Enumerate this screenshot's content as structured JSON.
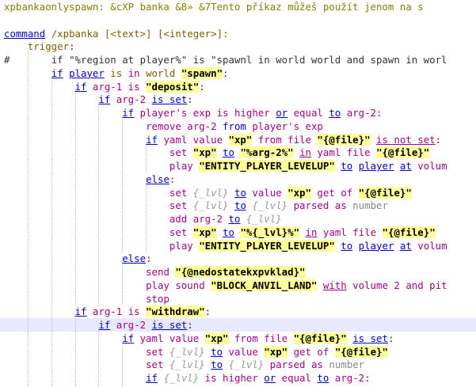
{
  "editor": {
    "lines": [
      {
        "indent": 0,
        "tokens": [
          {
            "t": "xpbankaonlyspawn: &cXP banka &8» &7Tento příkaz můžeš použít jenom na s",
            "c": "olv"
          }
        ]
      },
      {
        "indent": 0,
        "tokens": []
      },
      {
        "indent": 0,
        "tokens": [
          {
            "t": "command",
            "c": "kwu"
          },
          {
            "t": " ",
            "c": "plain"
          },
          {
            "t": "/xpbanka",
            "c": "fn"
          },
          {
            "t": " [<text>] [<integer>]:",
            "c": "fn"
          }
        ]
      },
      {
        "indent": 1,
        "tokens": [
          {
            "t": "trigger",
            "c": "fn"
          },
          {
            "t": ":",
            "c": "plain"
          }
        ]
      },
      {
        "indent": 2,
        "hash": true,
        "tokens": [
          {
            "t": "if \"%region at player%\" is \"spawnl in world world and spawn in worl",
            "c": "plain"
          }
        ]
      },
      {
        "indent": 2,
        "tokens": [
          {
            "t": "if",
            "c": "ul"
          },
          {
            "t": " ",
            "c": "plain"
          },
          {
            "t": "player",
            "c": "ul"
          },
          {
            "t": " is ",
            "c": "fn"
          },
          {
            "t": "in",
            "c": "mag"
          },
          {
            "t": " world ",
            "c": "fn"
          },
          {
            "t": "\"spawn\"",
            "c": "str"
          },
          {
            "t": ":",
            "c": "plain"
          }
        ]
      },
      {
        "indent": 3,
        "tokens": [
          {
            "t": "if",
            "c": "kwu"
          },
          {
            "t": " arg-1 is ",
            "c": "var"
          },
          {
            "t": "\"deposit\"",
            "c": "str"
          },
          {
            "t": ":",
            "c": "plain"
          }
        ]
      },
      {
        "indent": 4,
        "tokens": [
          {
            "t": "if",
            "c": "kwu"
          },
          {
            "t": " arg-2 ",
            "c": "var"
          },
          {
            "t": "is set",
            "c": "kwu"
          },
          {
            "t": ":",
            "c": "plain"
          }
        ]
      },
      {
        "indent": 5,
        "tokens": [
          {
            "t": "if",
            "c": "kwu"
          },
          {
            "t": " player's exp is higher ",
            "c": "var"
          },
          {
            "t": "or",
            "c": "kwu"
          },
          {
            "t": " equal ",
            "c": "var"
          },
          {
            "t": "to",
            "c": "kwu"
          },
          {
            "t": " arg-2:",
            "c": "var"
          }
        ]
      },
      {
        "indent": 6,
        "tokens": [
          {
            "t": "remove arg-2 ",
            "c": "var"
          },
          {
            "t": "from",
            "c": "kw"
          },
          {
            "t": " player's exp",
            "c": "var"
          }
        ]
      },
      {
        "indent": 6,
        "tokens": [
          {
            "t": "if",
            "c": "kwu"
          },
          {
            "t": " yaml value ",
            "c": "var"
          },
          {
            "t": "\"xp\"",
            "c": "str"
          },
          {
            "t": " from file ",
            "c": "var"
          },
          {
            "t": "\"{@file}\"",
            "c": "str"
          },
          {
            "t": " ",
            "c": "plain"
          },
          {
            "t": "is not set",
            "c": "magu"
          },
          {
            "t": ":",
            "c": "plain"
          }
        ]
      },
      {
        "indent": 7,
        "tokens": [
          {
            "t": "set",
            "c": "mag"
          },
          {
            "t": " ",
            "c": "plain"
          },
          {
            "t": "\"xp\"",
            "c": "str"
          },
          {
            "t": " ",
            "c": "plain"
          },
          {
            "t": "to",
            "c": "kwu"
          },
          {
            "t": " ",
            "c": "plain"
          },
          {
            "t": "\"%arg-2%\"",
            "c": "str"
          },
          {
            "t": " ",
            "c": "plain"
          },
          {
            "t": "in",
            "c": "magu"
          },
          {
            "t": " yaml file ",
            "c": "var"
          },
          {
            "t": "\"{@file}\"",
            "c": "str"
          }
        ]
      },
      {
        "indent": 7,
        "tokens": [
          {
            "t": "play ",
            "c": "var"
          },
          {
            "t": "\"ENTITY_PLAYER_LEVELUP\"",
            "c": "str"
          },
          {
            "t": " ",
            "c": "plain"
          },
          {
            "t": "to",
            "c": "kwu"
          },
          {
            "t": " ",
            "c": "plain"
          },
          {
            "t": "player",
            "c": "kwu"
          },
          {
            "t": " ",
            "c": "plain"
          },
          {
            "t": "at",
            "c": "kwu"
          },
          {
            "t": " volum",
            "c": "var"
          }
        ]
      },
      {
        "indent": 6,
        "tokens": [
          {
            "t": "else",
            "c": "kwu"
          },
          {
            "t": ":",
            "c": "plain"
          }
        ]
      },
      {
        "indent": 7,
        "tokens": [
          {
            "t": "set",
            "c": "mag"
          },
          {
            "t": " {_lvl} ",
            "c": "pal"
          },
          {
            "t": "to",
            "c": "kwu"
          },
          {
            "t": " value ",
            "c": "var"
          },
          {
            "t": "\"xp\"",
            "c": "str"
          },
          {
            "t": " get of ",
            "c": "var"
          },
          {
            "t": "\"{@file}\"",
            "c": "str"
          }
        ]
      },
      {
        "indent": 7,
        "tokens": [
          {
            "t": "set",
            "c": "mag"
          },
          {
            "t": " {_lvl} ",
            "c": "pal"
          },
          {
            "t": "to",
            "c": "kwu"
          },
          {
            "t": " {_lvl} ",
            "c": "pal"
          },
          {
            "t": "parsed as ",
            "c": "var"
          },
          {
            "t": "number",
            "c": "gry"
          }
        ]
      },
      {
        "indent": 7,
        "tokens": [
          {
            "t": "add arg-2 ",
            "c": "var"
          },
          {
            "t": "to",
            "c": "kwu"
          },
          {
            "t": " {_lvl}",
            "c": "pal"
          }
        ]
      },
      {
        "indent": 7,
        "tokens": [
          {
            "t": "set",
            "c": "mag"
          },
          {
            "t": " ",
            "c": "plain"
          },
          {
            "t": "\"xp\"",
            "c": "str"
          },
          {
            "t": " ",
            "c": "plain"
          },
          {
            "t": "to",
            "c": "kwu"
          },
          {
            "t": " ",
            "c": "plain"
          },
          {
            "t": "\"%{_lvl}%\"",
            "c": "str"
          },
          {
            "t": " ",
            "c": "plain"
          },
          {
            "t": "in",
            "c": "magu"
          },
          {
            "t": " yaml file ",
            "c": "var"
          },
          {
            "t": "\"{@file}\"",
            "c": "str"
          }
        ]
      },
      {
        "indent": 7,
        "tokens": [
          {
            "t": "play ",
            "c": "var"
          },
          {
            "t": "\"ENTITY_PLAYER_LEVELUP\"",
            "c": "str"
          },
          {
            "t": " ",
            "c": "plain"
          },
          {
            "t": "to",
            "c": "kwu"
          },
          {
            "t": " ",
            "c": "plain"
          },
          {
            "t": "player",
            "c": "kwu"
          },
          {
            "t": " ",
            "c": "plain"
          },
          {
            "t": "at",
            "c": "kwu"
          },
          {
            "t": " volum",
            "c": "var"
          }
        ]
      },
      {
        "indent": 5,
        "tokens": [
          {
            "t": "else",
            "c": "kwu"
          },
          {
            "t": ":",
            "c": "plain"
          }
        ]
      },
      {
        "indent": 6,
        "tokens": [
          {
            "t": "send ",
            "c": "var"
          },
          {
            "t": "\"{@nedostatekxpvklad}\"",
            "c": "str"
          }
        ]
      },
      {
        "indent": 6,
        "tokens": [
          {
            "t": "play sound ",
            "c": "var"
          },
          {
            "t": "\"BLOCK_ANVIL_LAND\"",
            "c": "str"
          },
          {
            "t": " ",
            "c": "plain"
          },
          {
            "t": "with",
            "c": "magu"
          },
          {
            "t": " volume 2 and pit",
            "c": "var"
          }
        ]
      },
      {
        "indent": 6,
        "tokens": [
          {
            "t": "stop",
            "c": "var"
          }
        ]
      },
      {
        "indent": 3,
        "tokens": [
          {
            "t": "if",
            "c": "kwu"
          },
          {
            "t": " arg-1 is ",
            "c": "var"
          },
          {
            "t": "\"withdraw\"",
            "c": "str"
          },
          {
            "t": ":",
            "c": "plain"
          }
        ]
      },
      {
        "indent": 4,
        "hl": true,
        "tokens": [
          {
            "t": "if",
            "c": "kwu"
          },
          {
            "t": " arg-2 ",
            "c": "var"
          },
          {
            "t": "is set",
            "c": "kwu"
          },
          {
            "t": ":",
            "c": "plain"
          }
        ]
      },
      {
        "indent": 5,
        "tokens": [
          {
            "t": "if",
            "c": "kwu"
          },
          {
            "t": " yaml value ",
            "c": "var"
          },
          {
            "t": "\"xp\"",
            "c": "str"
          },
          {
            "t": " from file ",
            "c": "var"
          },
          {
            "t": "\"{@file}\"",
            "c": "str"
          },
          {
            "t": " ",
            "c": "plain"
          },
          {
            "t": "is set",
            "c": "kwu"
          },
          {
            "t": ":",
            "c": "plain"
          }
        ]
      },
      {
        "indent": 6,
        "tokens": [
          {
            "t": "set",
            "c": "mag"
          },
          {
            "t": " {_lvl} ",
            "c": "pal"
          },
          {
            "t": "to",
            "c": "kwu"
          },
          {
            "t": " value ",
            "c": "var"
          },
          {
            "t": "\"xp\"",
            "c": "str"
          },
          {
            "t": " get of ",
            "c": "var"
          },
          {
            "t": "\"{@file}\"",
            "c": "str"
          }
        ]
      },
      {
        "indent": 6,
        "tokens": [
          {
            "t": "set",
            "c": "mag"
          },
          {
            "t": " {_lvl} ",
            "c": "pal"
          },
          {
            "t": "to",
            "c": "kwu"
          },
          {
            "t": " {_lvl} ",
            "c": "pal"
          },
          {
            "t": "parsed as ",
            "c": "var"
          },
          {
            "t": "number",
            "c": "gry"
          }
        ]
      },
      {
        "indent": 6,
        "tokens": [
          {
            "t": "if",
            "c": "kwu"
          },
          {
            "t": " {_lvl} ",
            "c": "pal"
          },
          {
            "t": "is higher ",
            "c": "var"
          },
          {
            "t": "or",
            "c": "kwu"
          },
          {
            "t": " equal ",
            "c": "var"
          },
          {
            "t": "to",
            "c": "kwu"
          },
          {
            "t": " arg-2:",
            "c": "var"
          }
        ]
      },
      {
        "indent": 6,
        "tokens": []
      }
    ]
  }
}
